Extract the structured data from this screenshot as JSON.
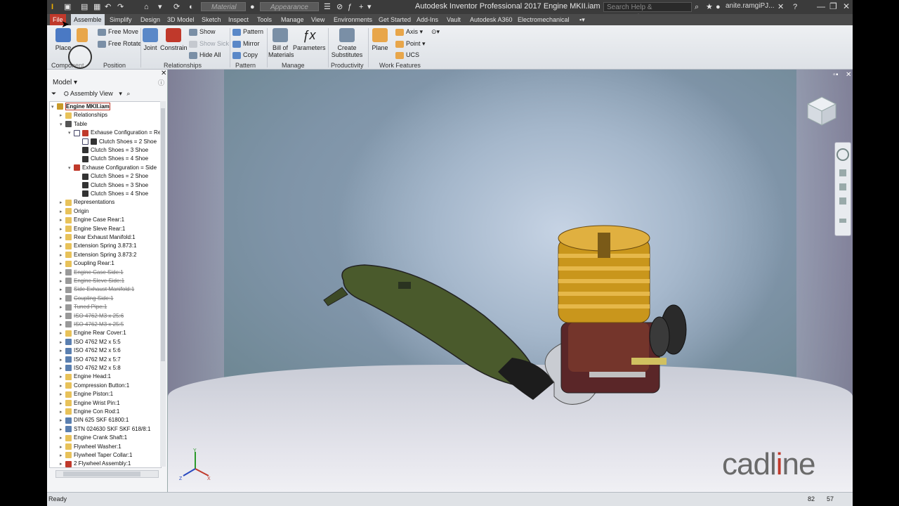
{
  "window": {
    "title": "Autodesk Inventor Professional 2017   Engine MKII.iam",
    "search_placeholder": "Search Help & Commands...",
    "user": "anite.ramgiPJ...",
    "material_combo": "Material",
    "appearance_combo": "Appearance",
    "minimize": "—",
    "restore": "❐",
    "close": "✕"
  },
  "tabs": [
    {
      "label": "File",
      "left": 0
    },
    {
      "label": "Assemble"
    },
    {
      "label": "Simplify"
    },
    {
      "label": "Design"
    },
    {
      "label": "3D Model"
    },
    {
      "label": "Sketch"
    },
    {
      "label": "Inspect"
    },
    {
      "label": "Tools"
    },
    {
      "label": "Manage"
    },
    {
      "label": "View"
    },
    {
      "label": "Environments"
    },
    {
      "label": "Get Started"
    },
    {
      "label": "Add-Ins"
    },
    {
      "label": "Vault"
    },
    {
      "label": "Autodesk A360"
    },
    {
      "label": "Electromechanical"
    }
  ],
  "ribbon": {
    "place": "Place",
    "free_move": "Free Move",
    "free_rotate": "Free Rotate",
    "joint": "Joint",
    "constrain": "Constrain",
    "show": "Show",
    "show_sick": "Show Sick",
    "hide_all": "Hide All",
    "pattern": "Pattern",
    "mirror": "Mirror",
    "copy": "Copy",
    "bill_of_materials_1": "Bill of",
    "bill_of_materials_2": "Materials",
    "parameters": "Parameters",
    "create_substitutes_1": "Create",
    "create_substitutes_2": "Substitutes",
    "plane": "Plane",
    "axis": "Axis",
    "point": "Point",
    "ucs": "UCS",
    "panels": {
      "component": "Component",
      "position": "Position",
      "relationships": "Relationships",
      "pattern": "Pattern",
      "manage": "Manage",
      "productivity": "Productivity",
      "work_features": "Work Features"
    }
  },
  "browser": {
    "title": "Model",
    "view": "Assembly View",
    "nodes": [
      {
        "label": "Engine MKII.iam",
        "depth": 0,
        "icon": "#c89a2a",
        "exp": "-",
        "highlight": true
      },
      {
        "label": "Relationships",
        "depth": 1,
        "icon": "#e8c25a",
        "exp": "+"
      },
      {
        "label": "Table",
        "depth": 1,
        "icon": "#555",
        "exp": "-"
      },
      {
        "label": "Exhause Configuration = Rear",
        "depth": 2,
        "icon": "#c0392b",
        "exp": "-",
        "check": true
      },
      {
        "label": "Clutch Shoes = 2 Shoe",
        "depth": 3,
        "icon": "#333",
        "check": true
      },
      {
        "label": "Clutch Shoes = 3 Shoe",
        "depth": 3,
        "icon": "#333"
      },
      {
        "label": "Clutch Shoes = 4 Shoe",
        "depth": 3,
        "icon": "#333"
      },
      {
        "label": "Exhause Configuration = Side",
        "depth": 2,
        "icon": "#c0392b",
        "exp": "-"
      },
      {
        "label": "Clutch Shoes = 2 Shoe",
        "depth": 3,
        "icon": "#333"
      },
      {
        "label": "Clutch Shoes = 3 Shoe",
        "depth": 3,
        "icon": "#333"
      },
      {
        "label": "Clutch Shoes = 4 Shoe",
        "depth": 3,
        "icon": "#333"
      },
      {
        "label": "Representations",
        "depth": 1,
        "icon": "#e8c25a",
        "exp": "+"
      },
      {
        "label": "Origin",
        "depth": 1,
        "icon": "#e8c25a",
        "exp": "+"
      },
      {
        "label": "Engine Case Rear:1",
        "depth": 1,
        "icon": "#e8c25a",
        "exp": "+"
      },
      {
        "label": "Engine Sleve Rear:1",
        "depth": 1,
        "icon": "#e8c25a",
        "exp": "+"
      },
      {
        "label": "Rear Exhaust Manifold:1",
        "depth": 1,
        "icon": "#e8c25a",
        "exp": "+"
      },
      {
        "label": "Extension Spring 3.873:1",
        "depth": 1,
        "icon": "#e8c25a",
        "exp": "+"
      },
      {
        "label": "Extension Spring 3.873:2",
        "depth": 1,
        "icon": "#e8c25a",
        "exp": "+"
      },
      {
        "label": "Coupling Rear:1",
        "depth": 1,
        "icon": "#e8c25a",
        "exp": "+"
      },
      {
        "label": "Engine Case Side:1",
        "depth": 1,
        "icon": "#999",
        "exp": "+",
        "sup": true
      },
      {
        "label": "Engine Sleve Side:1",
        "depth": 1,
        "icon": "#999",
        "exp": "+",
        "sup": true
      },
      {
        "label": "Side Exhaust Manifold:1",
        "depth": 1,
        "icon": "#999",
        "exp": "+",
        "sup": true
      },
      {
        "label": "Coupling Side:1",
        "depth": 1,
        "icon": "#999",
        "exp": "+",
        "sup": true
      },
      {
        "label": "Tuned Pipe:1",
        "depth": 1,
        "icon": "#999",
        "exp": "+",
        "sup": true
      },
      {
        "label": "ISO 4762 M3 x 25:6",
        "depth": 1,
        "icon": "#999",
        "exp": "+",
        "sup": true
      },
      {
        "label": "ISO 4762 M3 x 25:5",
        "depth": 1,
        "icon": "#999",
        "exp": "+",
        "sup": true
      },
      {
        "label": "Engine Rear Cover:1",
        "depth": 1,
        "icon": "#e8c25a",
        "exp": "+"
      },
      {
        "label": "ISO 4762 M2 x 5:5",
        "depth": 1,
        "icon": "#5a7fb0",
        "exp": "+"
      },
      {
        "label": "ISO 4762 M2 x 5:6",
        "depth": 1,
        "icon": "#5a7fb0",
        "exp": "+"
      },
      {
        "label": "ISO 4762 M2 x 5:7",
        "depth": 1,
        "icon": "#5a7fb0",
        "exp": "+"
      },
      {
        "label": "ISO 4762 M2 x 5:8",
        "depth": 1,
        "icon": "#5a7fb0",
        "exp": "+"
      },
      {
        "label": "Engine Head:1",
        "depth": 1,
        "icon": "#e8c25a",
        "exp": "+"
      },
      {
        "label": "Compression Button:1",
        "depth": 1,
        "icon": "#e8c25a",
        "exp": "+"
      },
      {
        "label": "Engine Piston:1",
        "depth": 1,
        "icon": "#e8c25a",
        "exp": "+"
      },
      {
        "label": "Engine Wrist Pin:1",
        "depth": 1,
        "icon": "#e8c25a",
        "exp": "+"
      },
      {
        "label": "Engine Con Rod:1",
        "depth": 1,
        "icon": "#e8c25a",
        "exp": "+"
      },
      {
        "label": "DIN 625 SKF 61800:1",
        "depth": 1,
        "icon": "#5a7fb0",
        "exp": "+"
      },
      {
        "label": "STN 024630 SKF SKF 618/8:1",
        "depth": 1,
        "icon": "#5a7fb0",
        "exp": "+"
      },
      {
        "label": "Engine Crank Shaft:1",
        "depth": 1,
        "icon": "#e8c25a",
        "exp": "+"
      },
      {
        "label": "Flywheel Washer:1",
        "depth": 1,
        "icon": "#e8c25a",
        "exp": "+"
      },
      {
        "label": "Flywheel Taper Collar:1",
        "depth": 1,
        "icon": "#e8c25a",
        "exp": "+"
      },
      {
        "label": "2 Flywheel Assembly:1",
        "depth": 1,
        "icon": "#c0392b",
        "exp": "+"
      }
    ]
  },
  "status": {
    "text": "Ready",
    "count_a": "82",
    "count_b": "57"
  },
  "logo": {
    "text_a": "cadl",
    "text_b": "i",
    "text_c": "ne"
  }
}
